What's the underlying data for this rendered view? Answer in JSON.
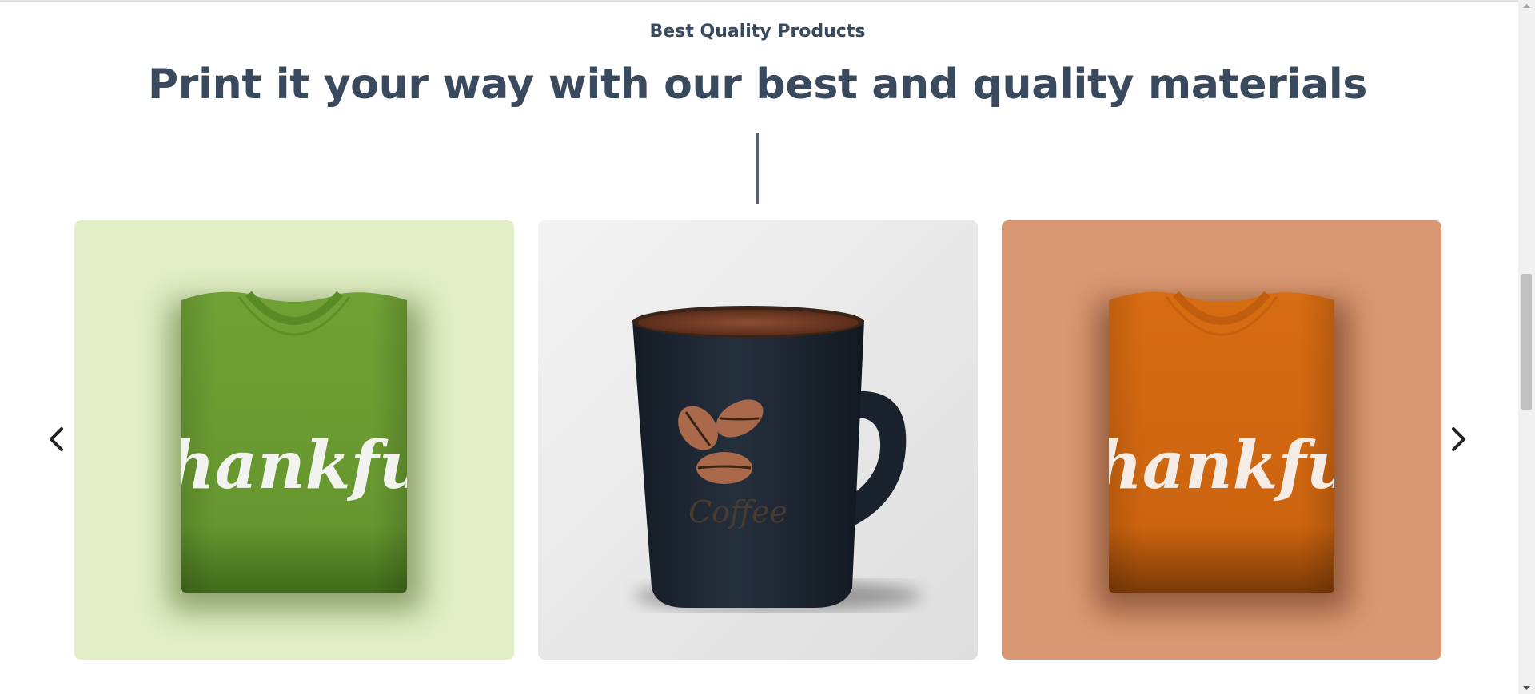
{
  "section": {
    "eyebrow": "Best Quality Products",
    "headline": "Print it your way with our best and quality materials"
  },
  "carousel": {
    "prev_icon": "chevron-left-icon",
    "next_icon": "chevron-right-icon",
    "items": [
      {
        "name": "green-tshirt",
        "print_text": "thankful",
        "background": "#e1eec6",
        "product_color": "#6b9b32"
      },
      {
        "name": "black-coffee-mug",
        "print_text": "Coffee",
        "background": "#e6e6e6",
        "product_color": "#1f2733"
      },
      {
        "name": "orange-tshirt",
        "print_text": "thankful",
        "background": "#d99873",
        "product_color": "#d2680f"
      }
    ]
  },
  "colors": {
    "text_primary": "#3a4a5e",
    "divider": "#556170"
  }
}
